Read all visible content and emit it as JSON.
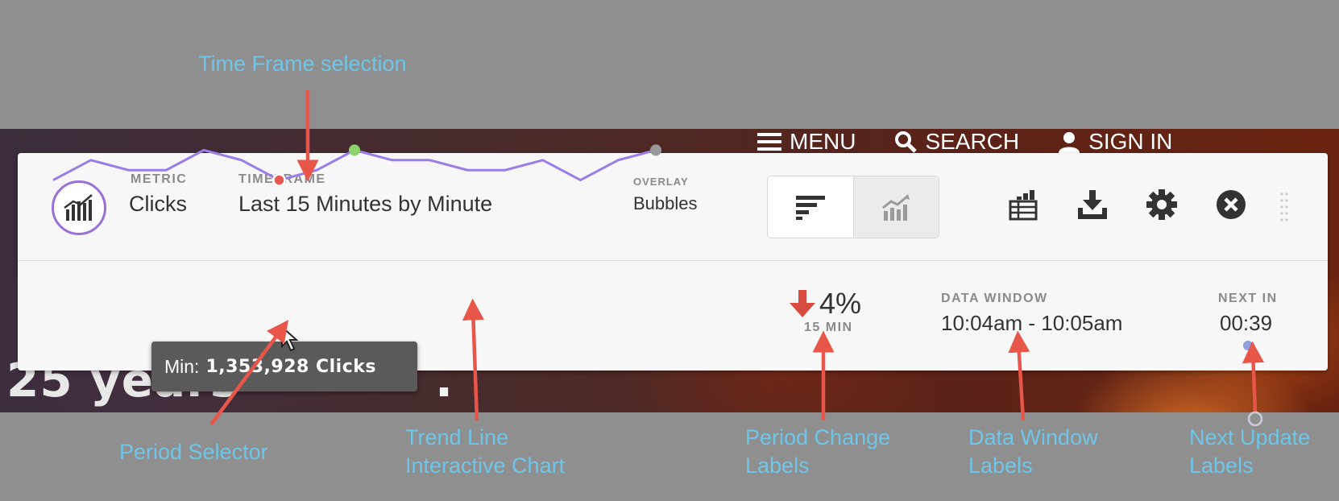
{
  "annotations": {
    "timeframe": "Time Frame selection",
    "period_selector": "Period Selector",
    "trend_line_1": "Trend Line",
    "trend_line_2": "Interactive Chart",
    "period_change_1": "Period Change",
    "period_change_2": "Labels",
    "data_window_1": "Data Window",
    "data_window_2": "Labels",
    "next_update_1": "Next Update",
    "next_update_2": "Labels"
  },
  "nav": {
    "menu": "MENU",
    "search": "SEARCH",
    "signin": "SIGN IN"
  },
  "hero": {
    "text_left": "25 years",
    "text_right": "."
  },
  "panel": {
    "metric_label": "METRIC",
    "metric_value": "Clicks",
    "timeframe_label": "TIMEFRAME",
    "timeframe_value": "Last 15 Minutes by Minute",
    "overlay_label": "OVERLAY",
    "overlay_value": "Bubbles",
    "change_value": "4%",
    "change_period": "15 MIN",
    "data_window_label": "DATA WINDOW",
    "data_window_value": "10:04am - 10:05am",
    "next_in_label": "NEXT IN",
    "next_in_value": "00:39"
  },
  "tooltip": {
    "prefix": "Min:",
    "value": "1,353,928 Clicks"
  },
  "icons": [
    "menu-icon",
    "search-icon",
    "user-icon",
    "metric-chart-icon",
    "ranked-bars-icon",
    "trend-chart-icon",
    "table-icon",
    "download-icon",
    "settings-icon",
    "close-icon",
    "drag-handle-icon",
    "down-arrow-icon"
  ],
  "colors": {
    "trend_line": "#9a7de8",
    "selected_point": "#e85a4f",
    "max_point": "#8bd36a",
    "last_point": "#999999",
    "accent": "#9a6fd9",
    "annotation": "#6fc6e8",
    "arrow": "#e8564a"
  },
  "chart_data": {
    "type": "line",
    "series": [
      {
        "values": [
          10,
          30,
          20,
          20,
          40,
          30,
          10,
          20,
          40,
          30,
          30,
          20,
          20,
          30,
          10,
          30,
          40
        ]
      }
    ],
    "min_index": 6,
    "max_index": 8,
    "grid": false
  }
}
